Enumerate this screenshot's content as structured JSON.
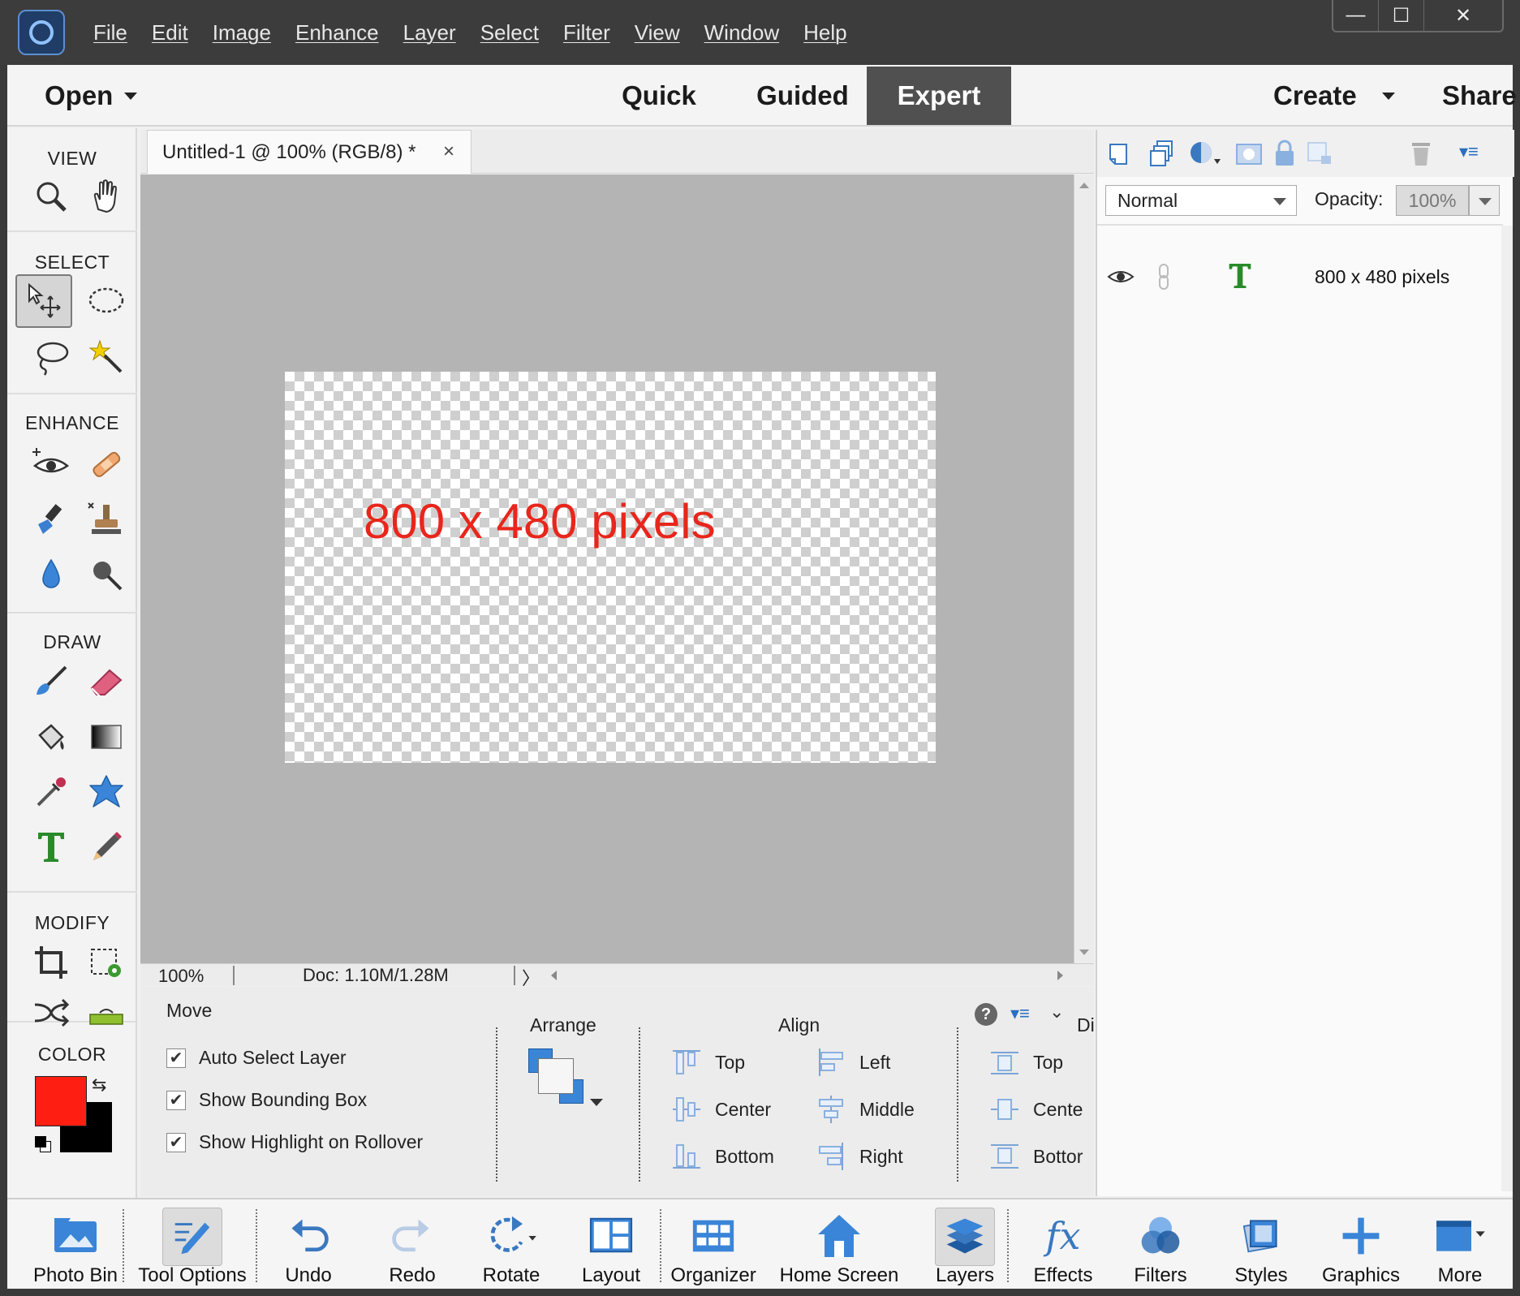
{
  "window": {
    "menu": [
      "File",
      "Edit",
      "Image",
      "Enhance",
      "Layer",
      "Select",
      "Filter",
      "View",
      "Window",
      "Help"
    ],
    "controls": {
      "minimize": "—",
      "maximize": "☐",
      "close": "✕"
    }
  },
  "modebar": {
    "open": "Open",
    "quick": "Quick",
    "guided": "Guided",
    "expert": "Expert",
    "create": "Create",
    "share": "Share"
  },
  "toolbox": {
    "view": "VIEW",
    "select": "SELECT",
    "enhance": "ENHANCE",
    "draw": "DRAW",
    "modify": "MODIFY",
    "color": "COLOR",
    "foreground": "#ff1f12",
    "background": "#000000"
  },
  "document": {
    "tab_title": "Untitled-1 @ 100% (RGB/8) *",
    "close": "×",
    "text": "800 x 480 pixels",
    "text_color": "#e8261c"
  },
  "status": {
    "zoom": "100%",
    "doc": "Doc: 1.10M/1.28M",
    "more": "〉"
  },
  "tool_options": {
    "title": "Move",
    "checkboxes": [
      {
        "label": "Auto Select Layer",
        "checked": true
      },
      {
        "label": "Show Bounding Box",
        "checked": true
      },
      {
        "label": "Show Highlight on Rollover",
        "checked": true
      }
    ],
    "arrange": "Arrange",
    "align": "Align",
    "align_items": {
      "top": "Top",
      "center": "Center",
      "bottom": "Bottom",
      "left": "Left",
      "middle": "Middle",
      "right": "Right"
    },
    "distribute_title": "Di",
    "distribute_items": {
      "top": "Top",
      "center": "Cente",
      "bottom": "Bottor"
    }
  },
  "layers": {
    "blend_mode": "Normal",
    "opacity_label": "Opacity:",
    "opacity": "100%",
    "layer_name": "800 x 480 pixels"
  },
  "taskbar": {
    "photo_bin": "Photo Bin",
    "tool_options": "Tool Options",
    "undo": "Undo",
    "redo": "Redo",
    "rotate": "Rotate",
    "layout": "Layout",
    "organizer": "Organizer",
    "home_screen": "Home Screen",
    "layers": "Layers",
    "effects": "Effects",
    "filters": "Filters",
    "styles": "Styles",
    "graphics": "Graphics",
    "more": "More"
  }
}
